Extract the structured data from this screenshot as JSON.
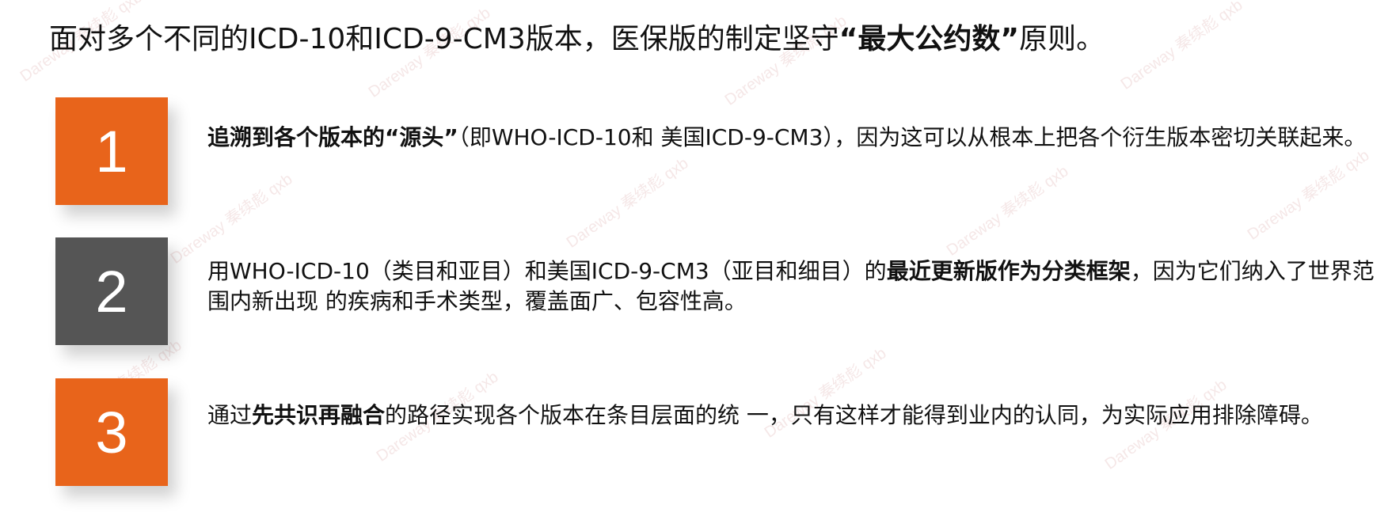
{
  "watermark_text": "Dareway 秦续彪 qxb",
  "headline": {
    "prefix": "面对多个不同的ICD-10和ICD-9-CM3版本，医保版的制定坚守",
    "emphasis": "“最大公约数”",
    "suffix": "原则。"
  },
  "items": [
    {
      "number": "1",
      "color": "#E8641B",
      "bold": "追溯到各个版本的“源头”",
      "text": "（即WHO-ICD-10和 美国ICD-9-CM3），因为这可以从根本上把各个衍生版本密切关联起来。"
    },
    {
      "number": "2",
      "color": "#555555",
      "pre": "用WHO-ICD-10（类目和亚目）和美国ICD-9-CM3（亚目和细目）的",
      "bold": "最近更新版作为分类框架",
      "post": "，因为它们纳入了世界范围内新出现 的疾病和手术类型，覆盖面广、包容性高。"
    },
    {
      "number": "3",
      "color": "#E8641B",
      "pre": "通过",
      "bold": "先共识再融合",
      "post": "的路径实现各个版本在条目层面的统 一，只有这样才能得到业内的认同，为实际应用排除障碍。"
    }
  ]
}
